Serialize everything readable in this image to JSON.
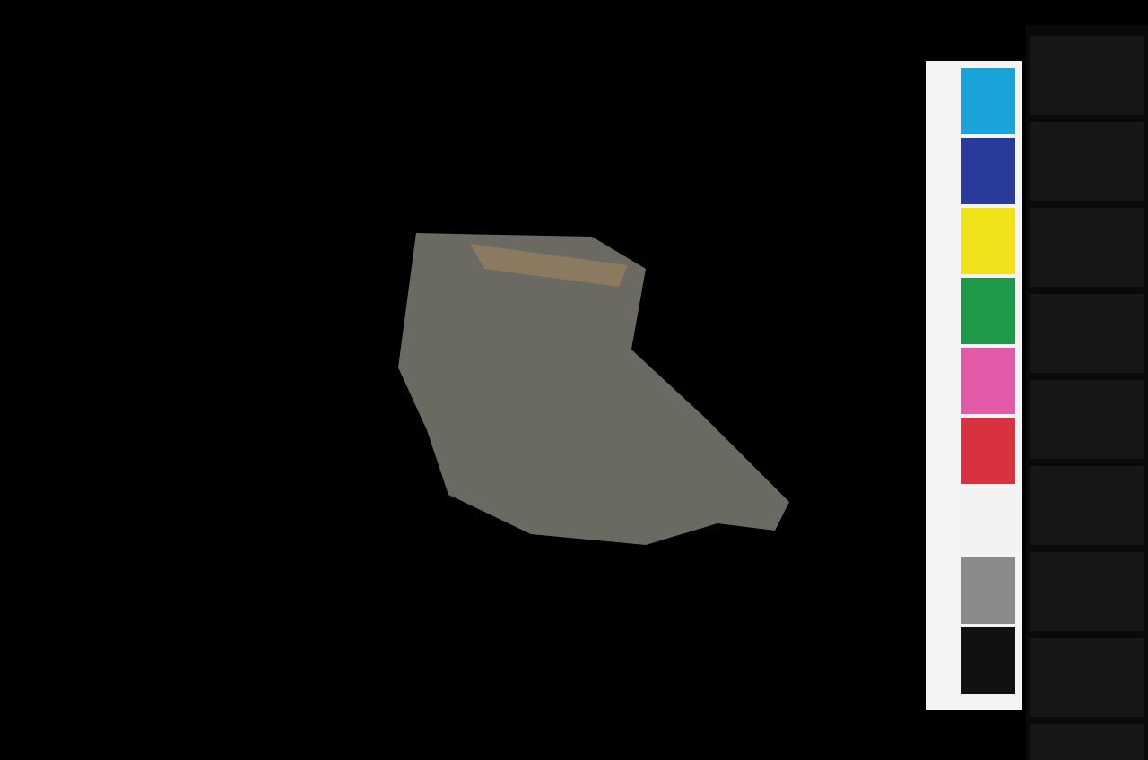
{
  "photo": {
    "kind": "artifact-photo"
  }
}
